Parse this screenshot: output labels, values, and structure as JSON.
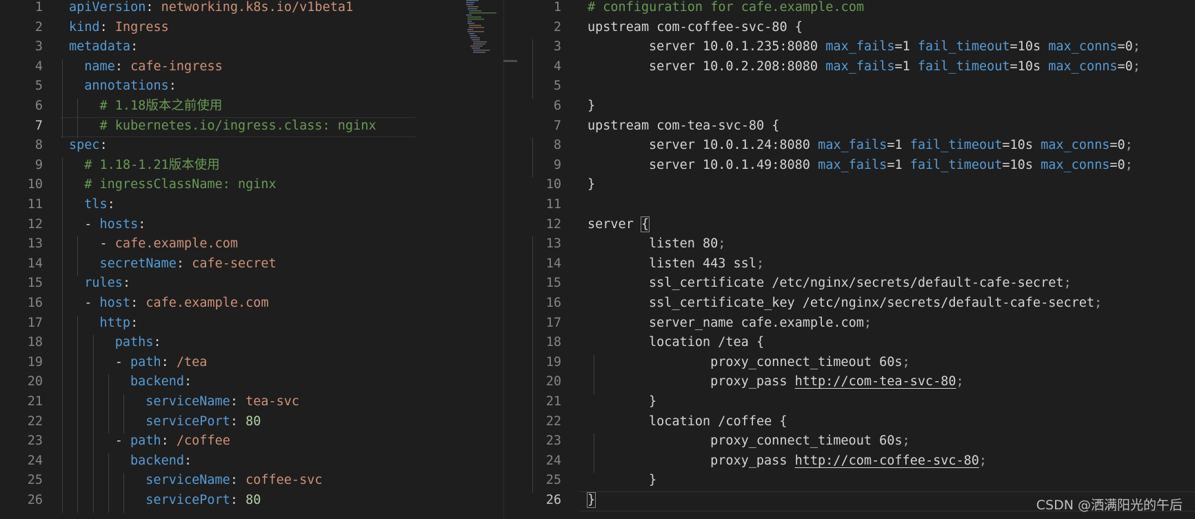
{
  "left_editor": {
    "language": "yaml",
    "active_line": 7,
    "lines": [
      {
        "n": "1",
        "indent": 0,
        "tokens": [
          {
            "t": "apiVersion",
            "c": "k"
          },
          {
            "t": ": ",
            "c": "p"
          },
          {
            "t": "networking.k8s.io/v1beta1",
            "c": "s"
          }
        ]
      },
      {
        "n": "2",
        "indent": 0,
        "tokens": [
          {
            "t": "kind",
            "c": "k"
          },
          {
            "t": ": ",
            "c": "p"
          },
          {
            "t": "Ingress",
            "c": "s"
          }
        ]
      },
      {
        "n": "3",
        "indent": 0,
        "tokens": [
          {
            "t": "metadata",
            "c": "k"
          },
          {
            "t": ":",
            "c": "p"
          }
        ]
      },
      {
        "n": "4",
        "indent": 1,
        "tokens": [
          {
            "t": "name",
            "c": "k"
          },
          {
            "t": ": ",
            "c": "p"
          },
          {
            "t": "cafe-ingress",
            "c": "s"
          }
        ]
      },
      {
        "n": "5",
        "indent": 1,
        "tokens": [
          {
            "t": "annotations",
            "c": "k"
          },
          {
            "t": ":",
            "c": "p"
          }
        ]
      },
      {
        "n": "6",
        "indent": 2,
        "tokens": [
          {
            "t": "# 1.18版本之前使用",
            "c": "c"
          }
        ]
      },
      {
        "n": "7",
        "indent": 2,
        "tokens": [
          {
            "t": "# kubernetes.io/ingress.class: nginx",
            "c": "c"
          }
        ]
      },
      {
        "n": "8",
        "indent": 0,
        "tokens": [
          {
            "t": "spec",
            "c": "k"
          },
          {
            "t": ":",
            "c": "p"
          }
        ]
      },
      {
        "n": "9",
        "indent": 1,
        "tokens": [
          {
            "t": "# 1.18-1.21版本使用",
            "c": "c"
          }
        ]
      },
      {
        "n": "10",
        "indent": 1,
        "tokens": [
          {
            "t": "# ingressClassName: nginx",
            "c": "c"
          }
        ]
      },
      {
        "n": "11",
        "indent": 1,
        "tokens": [
          {
            "t": "tls",
            "c": "k"
          },
          {
            "t": ":",
            "c": "p"
          }
        ]
      },
      {
        "n": "12",
        "indent": 1,
        "tokens": [
          {
            "t": "- ",
            "c": "p"
          },
          {
            "t": "hosts",
            "c": "k"
          },
          {
            "t": ":",
            "c": "p"
          }
        ]
      },
      {
        "n": "13",
        "indent": 2,
        "tokens": [
          {
            "t": "- ",
            "c": "p"
          },
          {
            "t": "cafe.example.com",
            "c": "s"
          }
        ]
      },
      {
        "n": "14",
        "indent": 2,
        "tokens": [
          {
            "t": "secretName",
            "c": "k"
          },
          {
            "t": ": ",
            "c": "p"
          },
          {
            "t": "cafe-secret",
            "c": "s"
          }
        ]
      },
      {
        "n": "15",
        "indent": 1,
        "tokens": [
          {
            "t": "rules",
            "c": "k"
          },
          {
            "t": ":",
            "c": "p"
          }
        ]
      },
      {
        "n": "16",
        "indent": 1,
        "tokens": [
          {
            "t": "- ",
            "c": "p"
          },
          {
            "t": "host",
            "c": "k"
          },
          {
            "t": ": ",
            "c": "p"
          },
          {
            "t": "cafe.example.com",
            "c": "s"
          }
        ]
      },
      {
        "n": "17",
        "indent": 2,
        "tokens": [
          {
            "t": "http",
            "c": "k"
          },
          {
            "t": ":",
            "c": "p"
          }
        ]
      },
      {
        "n": "18",
        "indent": 3,
        "tokens": [
          {
            "t": "paths",
            "c": "k"
          },
          {
            "t": ":",
            "c": "p"
          }
        ]
      },
      {
        "n": "19",
        "indent": 3,
        "tokens": [
          {
            "t": "- ",
            "c": "p"
          },
          {
            "t": "path",
            "c": "k"
          },
          {
            "t": ": ",
            "c": "p"
          },
          {
            "t": "/tea",
            "c": "s"
          }
        ]
      },
      {
        "n": "20",
        "indent": 4,
        "tokens": [
          {
            "t": "backend",
            "c": "k"
          },
          {
            "t": ":",
            "c": "p"
          }
        ]
      },
      {
        "n": "21",
        "indent": 5,
        "tokens": [
          {
            "t": "serviceName",
            "c": "k"
          },
          {
            "t": ": ",
            "c": "p"
          },
          {
            "t": "tea-svc",
            "c": "s"
          }
        ]
      },
      {
        "n": "22",
        "indent": 5,
        "tokens": [
          {
            "t": "servicePort",
            "c": "k"
          },
          {
            "t": ": ",
            "c": "p"
          },
          {
            "t": "80",
            "c": "n"
          }
        ]
      },
      {
        "n": "23",
        "indent": 3,
        "tokens": [
          {
            "t": "- ",
            "c": "p"
          },
          {
            "t": "path",
            "c": "k"
          },
          {
            "t": ": ",
            "c": "p"
          },
          {
            "t": "/coffee",
            "c": "s"
          }
        ]
      },
      {
        "n": "24",
        "indent": 4,
        "tokens": [
          {
            "t": "backend",
            "c": "k"
          },
          {
            "t": ":",
            "c": "p"
          }
        ]
      },
      {
        "n": "25",
        "indent": 5,
        "tokens": [
          {
            "t": "serviceName",
            "c": "k"
          },
          {
            "t": ": ",
            "c": "p"
          },
          {
            "t": "coffee-svc",
            "c": "s"
          }
        ]
      },
      {
        "n": "26",
        "indent": 5,
        "tokens": [
          {
            "t": "servicePort",
            "c": "k"
          },
          {
            "t": ": ",
            "c": "p"
          },
          {
            "t": "80",
            "c": "n"
          }
        ]
      }
    ]
  },
  "right_editor": {
    "language": "nginx",
    "active_line": 26,
    "lines": [
      {
        "n": "1",
        "indent": 0,
        "tokens": [
          {
            "t": "# configuration for cafe.example.com",
            "c": "c"
          }
        ]
      },
      {
        "n": "2",
        "indent": 0,
        "tokens": [
          {
            "t": "upstream com-coffee-svc-80 {",
            "c": "w"
          }
        ]
      },
      {
        "n": "3",
        "indent": 1,
        "tokens": [
          {
            "t": "server 10.0.1.235:8080 ",
            "c": "w"
          },
          {
            "t": "max_fails",
            "c": "k"
          },
          {
            "t": "=1 ",
            "c": "w"
          },
          {
            "t": "fail_timeout",
            "c": "k"
          },
          {
            "t": "=10s ",
            "c": "w"
          },
          {
            "t": "max_conns",
            "c": "k"
          },
          {
            "t": "=0",
            "c": "w"
          },
          {
            "t": ";",
            "c": "sc"
          }
        ]
      },
      {
        "n": "4",
        "indent": 1,
        "tokens": [
          {
            "t": "server 10.0.2.208:8080 ",
            "c": "w"
          },
          {
            "t": "max_fails",
            "c": "k"
          },
          {
            "t": "=1 ",
            "c": "w"
          },
          {
            "t": "fail_timeout",
            "c": "k"
          },
          {
            "t": "=10s ",
            "c": "w"
          },
          {
            "t": "max_conns",
            "c": "k"
          },
          {
            "t": "=0",
            "c": "w"
          },
          {
            "t": ";",
            "c": "sc"
          }
        ]
      },
      {
        "n": "5",
        "indent": 1,
        "tokens": []
      },
      {
        "n": "6",
        "indent": 0,
        "tokens": [
          {
            "t": "}",
            "c": "w"
          }
        ]
      },
      {
        "n": "7",
        "indent": 0,
        "tokens": [
          {
            "t": "upstream com-tea-svc-80 {",
            "c": "w"
          }
        ]
      },
      {
        "n": "8",
        "indent": 1,
        "tokens": [
          {
            "t": "server 10.0.1.24:8080 ",
            "c": "w"
          },
          {
            "t": "max_fails",
            "c": "k"
          },
          {
            "t": "=1 ",
            "c": "w"
          },
          {
            "t": "fail_timeout",
            "c": "k"
          },
          {
            "t": "=10s ",
            "c": "w"
          },
          {
            "t": "max_conns",
            "c": "k"
          },
          {
            "t": "=0",
            "c": "w"
          },
          {
            "t": ";",
            "c": "sc"
          }
        ]
      },
      {
        "n": "9",
        "indent": 1,
        "tokens": [
          {
            "t": "server 10.0.1.49:8080 ",
            "c": "w"
          },
          {
            "t": "max_fails",
            "c": "k"
          },
          {
            "t": "=1 ",
            "c": "w"
          },
          {
            "t": "fail_timeout",
            "c": "k"
          },
          {
            "t": "=10s ",
            "c": "w"
          },
          {
            "t": "max_conns",
            "c": "k"
          },
          {
            "t": "=0",
            "c": "w"
          },
          {
            "t": ";",
            "c": "sc"
          }
        ]
      },
      {
        "n": "10",
        "indent": 0,
        "tokens": [
          {
            "t": "}",
            "c": "w"
          }
        ]
      },
      {
        "n": "11",
        "indent": 0,
        "tokens": []
      },
      {
        "n": "12",
        "indent": 0,
        "tokens": [
          {
            "t": "server ",
            "c": "w"
          },
          {
            "t": "{",
            "c": "w",
            "box": true
          }
        ]
      },
      {
        "n": "13",
        "indent": 1,
        "tokens": [
          {
            "t": "listen 80",
            "c": "w"
          },
          {
            "t": ";",
            "c": "sc"
          }
        ]
      },
      {
        "n": "14",
        "indent": 1,
        "tokens": [
          {
            "t": "listen 443 ssl",
            "c": "w"
          },
          {
            "t": ";",
            "c": "sc"
          }
        ]
      },
      {
        "n": "15",
        "indent": 1,
        "tokens": [
          {
            "t": "ssl_certificate /etc/nginx/secrets/default-cafe-secret",
            "c": "w"
          },
          {
            "t": ";",
            "c": "sc"
          }
        ]
      },
      {
        "n": "16",
        "indent": 1,
        "tokens": [
          {
            "t": "ssl_certificate_key /etc/nginx/secrets/default-cafe-secret",
            "c": "w"
          },
          {
            "t": ";",
            "c": "sc"
          }
        ]
      },
      {
        "n": "17",
        "indent": 1,
        "tokens": [
          {
            "t": "server_name cafe.example.com",
            "c": "w"
          },
          {
            "t": ";",
            "c": "sc"
          }
        ]
      },
      {
        "n": "18",
        "indent": 1,
        "tokens": [
          {
            "t": "location /tea {",
            "c": "w"
          }
        ]
      },
      {
        "n": "19",
        "indent": 2,
        "tokens": [
          {
            "t": "proxy_connect_timeout 60s",
            "c": "w"
          },
          {
            "t": ";",
            "c": "sc"
          }
        ]
      },
      {
        "n": "20",
        "indent": 2,
        "tokens": [
          {
            "t": "proxy_pass ",
            "c": "w"
          },
          {
            "t": "http://com-tea-svc-80",
            "c": "w",
            "link": true
          },
          {
            "t": ";",
            "c": "sc"
          }
        ]
      },
      {
        "n": "21",
        "indent": 1,
        "tokens": [
          {
            "t": "}",
            "c": "w"
          }
        ]
      },
      {
        "n": "22",
        "indent": 1,
        "tokens": [
          {
            "t": "location /coffee {",
            "c": "w"
          }
        ]
      },
      {
        "n": "23",
        "indent": 2,
        "tokens": [
          {
            "t": "proxy_connect_timeout 60s",
            "c": "w"
          },
          {
            "t": ";",
            "c": "sc"
          }
        ]
      },
      {
        "n": "24",
        "indent": 2,
        "tokens": [
          {
            "t": "proxy_pass ",
            "c": "w"
          },
          {
            "t": "http://com-coffee-svc-80",
            "c": "w",
            "link": true
          },
          {
            "t": ";",
            "c": "sc"
          }
        ]
      },
      {
        "n": "25",
        "indent": 1,
        "tokens": [
          {
            "t": "}",
            "c": "w"
          }
        ]
      },
      {
        "n": "26",
        "indent": 0,
        "tokens": [
          {
            "t": "}",
            "c": "w",
            "box": true
          }
        ]
      }
    ]
  },
  "watermark": "CSDN @洒满阳光的午后",
  "colors": {
    "background": "#1e1e1e",
    "line_number": "#858585",
    "key": "#569cd6",
    "string": "#ce9178",
    "number": "#b5cea8",
    "comment": "#6a9955"
  }
}
